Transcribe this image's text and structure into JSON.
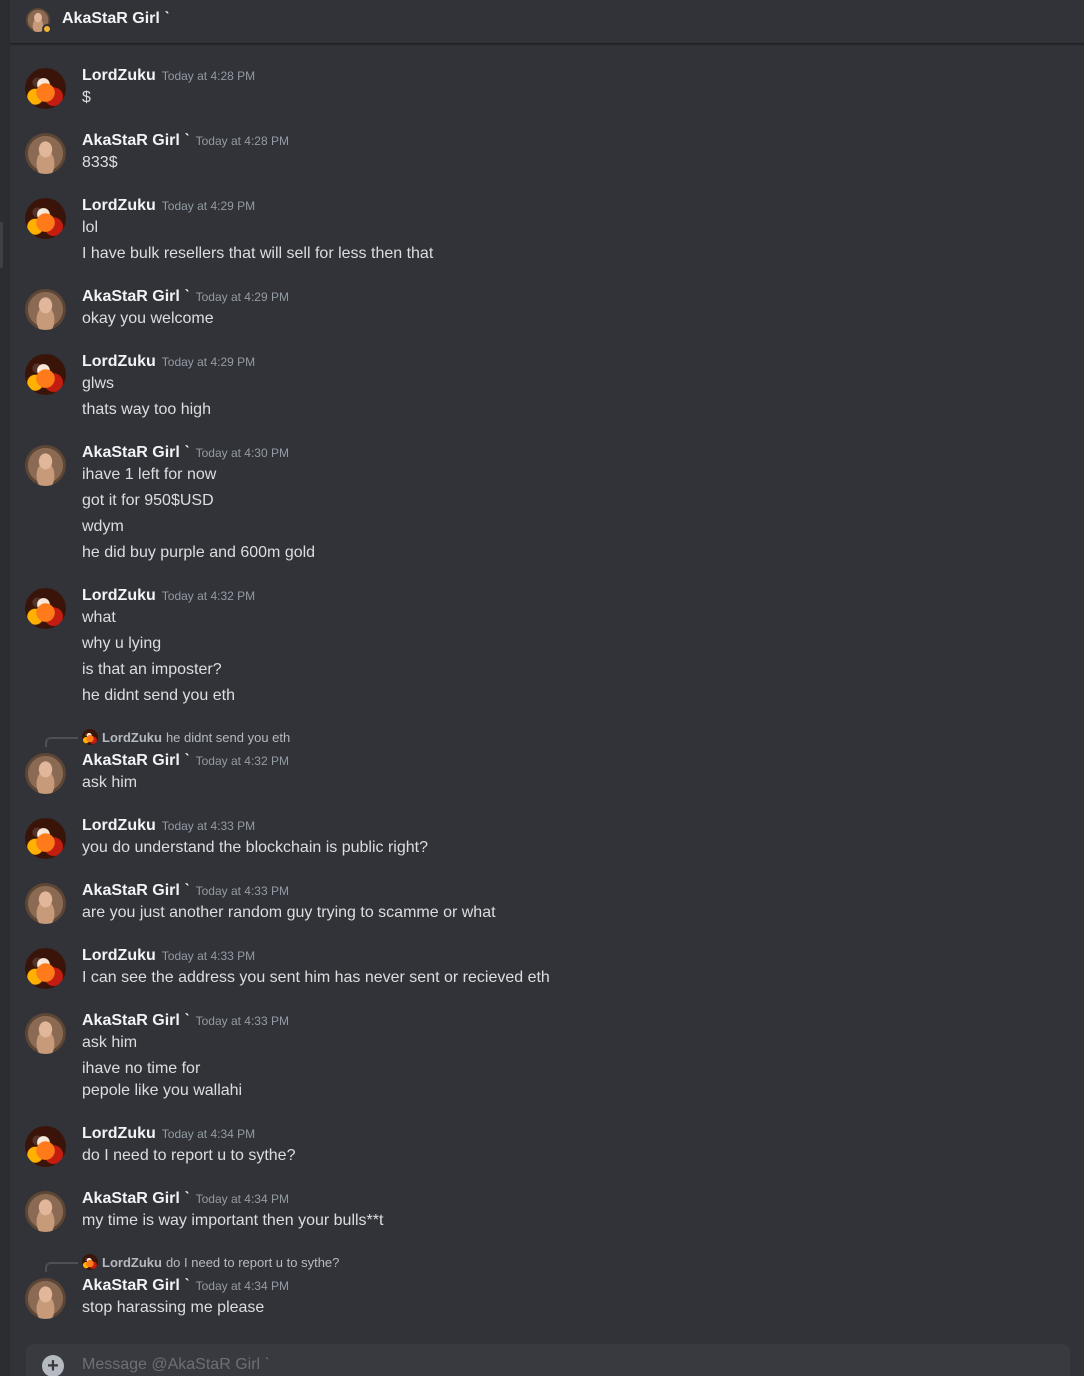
{
  "header": {
    "title": "AkaStaR Girl ˋ"
  },
  "composer": {
    "placeholder": "Message @AkaStaR Girl ˋ"
  },
  "messages": [
    {
      "author": "LordZuku",
      "time": "Today at 4:28 PM",
      "lines": [
        "$"
      ]
    },
    {
      "author": "AkaStaR Girl ˋ",
      "time": "Today at 4:28 PM",
      "lines": [
        "833$"
      ]
    },
    {
      "author": "LordZuku",
      "time": "Today at 4:29 PM",
      "lines": [
        "lol",
        "I have bulk resellers that will sell for less then that"
      ]
    },
    {
      "author": "AkaStaR Girl ˋ",
      "time": "Today at 4:29 PM",
      "lines": [
        "okay you  welcome"
      ]
    },
    {
      "author": "LordZuku",
      "time": "Today at 4:29 PM",
      "lines": [
        "glws",
        "thats way too high"
      ]
    },
    {
      "author": "AkaStaR Girl ˋ",
      "time": "Today at 4:30 PM",
      "lines": [
        "ihave 1 left for now",
        "got it for 950$USD",
        "wdym",
        "he did buy purple and 600m gold"
      ]
    },
    {
      "author": "LordZuku",
      "time": "Today at 4:32 PM",
      "lines": [
        "what",
        "why u lying",
        "is that an imposter?",
        "he didnt send you eth"
      ]
    },
    {
      "author": "AkaStaR Girl ˋ",
      "time": "Today at 4:32 PM",
      "reply": {
        "author": "LordZuku",
        "text": "he didnt send you eth"
      },
      "lines": [
        "ask him"
      ]
    },
    {
      "author": "LordZuku",
      "time": "Today at 4:33 PM",
      "lines": [
        "you do understand the blockchain is public right?"
      ]
    },
    {
      "author": "AkaStaR Girl ˋ",
      "time": "Today at 4:33 PM",
      "lines": [
        "are you just another random guy trying to scamme or what"
      ]
    },
    {
      "author": "LordZuku",
      "time": "Today at 4:33 PM",
      "lines": [
        "I can see the address you sent him has never sent or recieved eth"
      ]
    },
    {
      "author": "AkaStaR Girl ˋ",
      "time": "Today at 4:33 PM",
      "lines": [
        "ask him",
        "ihave no time for",
        "pepole like you wallahi"
      ]
    },
    {
      "author": "LordZuku",
      "time": "Today at 4:34 PM",
      "lines": [
        "do I need to report u to sythe?"
      ]
    },
    {
      "author": "AkaStaR Girl ˋ",
      "time": "Today at 4:34 PM",
      "lines": [
        "my time is way important then your bulls**t"
      ]
    },
    {
      "author": "AkaStaR Girl ˋ",
      "time": "Today at 4:34 PM",
      "reply": {
        "author": "LordZuku",
        "text": "do I need to report u to sythe?"
      },
      "lines": [
        "stop harassing me please"
      ]
    }
  ]
}
